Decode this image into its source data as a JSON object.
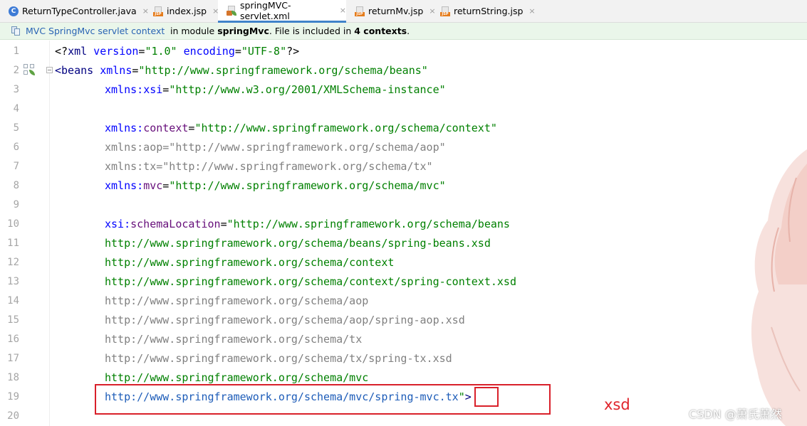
{
  "tabs": [
    {
      "label": "ReturnTypeController.java",
      "icon": "java-class-icon",
      "active": false
    },
    {
      "label": "index.jsp",
      "icon": "jsp-file-icon",
      "active": false
    },
    {
      "label": "springMVC-servlet.xml",
      "icon": "spring-xml-icon",
      "active": true
    },
    {
      "label": "returnMv.jsp",
      "icon": "jsp-file-icon",
      "active": false
    },
    {
      "label": "returnString.jsp",
      "icon": "jsp-file-icon",
      "active": false
    }
  ],
  "tab_close_glyph": "×",
  "banner": {
    "context_link": "MVC SpringMvc servlet context",
    "prefix": "in module ",
    "module": "springMvc",
    "middle": ". File is included in ",
    "count": "4 contexts",
    "suffix": "."
  },
  "editor": {
    "line_numbers": [
      "1",
      "2",
      "3",
      "4",
      "5",
      "6",
      "7",
      "8",
      "9",
      "10",
      "11",
      "12",
      "13",
      "14",
      "15",
      "16",
      "17",
      "18",
      "19",
      "20"
    ],
    "lines": {
      "l1": {
        "a": "<?",
        "b": "xml",
        "c": " version",
        "d": "=",
        "e": "\"1.0\"",
        "f": " encoding",
        "g": "=",
        "h": "\"UTF-8\"",
        "i": "?>"
      },
      "l2": {
        "a": "<",
        "b": "beans",
        "c": " xmlns",
        "d": "=",
        "e": "\"http://www.springframework.org/schema/beans\""
      },
      "l3": {
        "a": "xmlns",
        "b": ":",
        "c": "xsi",
        "d": "=",
        "e": "\"http://www.w3.org/2001/XMLSchema-instance\""
      },
      "l5": {
        "a": "xmlns",
        "b": ":",
        "c": "context",
        "d": "=",
        "e": "\"http://www.springframework.org/schema/context\""
      },
      "l6": {
        "text": "xmlns:aop=\"http://www.springframework.org/schema/aop\""
      },
      "l7": {
        "text": "xmlns:tx=\"http://www.springframework.org/schema/tx\""
      },
      "l8": {
        "a": "xmlns",
        "b": ":",
        "c": "mvc",
        "d": "=",
        "e": "\"http://www.springframework.org/schema/mvc\""
      },
      "l10": {
        "a": "xsi",
        "b": ":",
        "c": "schemaLocation",
        "d": "=",
        "e": "\"http://www.springframework.org/schema/beans"
      },
      "l11": {
        "text": "http://www.springframework.org/schema/beans/spring-beans.xsd"
      },
      "l12": {
        "text": "http://www.springframework.org/schema/context"
      },
      "l13": {
        "text": "http://www.springframework.org/schema/context/spring-context.xsd"
      },
      "l14": {
        "text": "http://www.springframework.org/schema/aop"
      },
      "l15": {
        "text": "http://www.springframework.org/schema/aop/spring-aop.xsd"
      },
      "l16": {
        "text": "http://www.springframework.org/schema/tx"
      },
      "l17": {
        "text": "http://www.springframework.org/schema/tx/spring-tx.xsd"
      },
      "l18": {
        "text": "http://www.springframework.org/schema/mvc"
      },
      "l19": {
        "a": "http://www.springframework.org/schema/mvc/spring-mvc",
        "b": ".tx",
        "c": "\"",
        "d": ">"
      }
    }
  },
  "annotation": {
    "text": "xsd",
    "color": "#e0242b"
  },
  "watermark": "CSDN @萧氏萧然",
  "colors": {
    "tag": "#000080",
    "attr": "#0000ff",
    "namespace": "#660e7a",
    "value": "#008000",
    "unused": "#808080",
    "link": "#1d5cb8",
    "annotation_box": "#d9202a"
  }
}
